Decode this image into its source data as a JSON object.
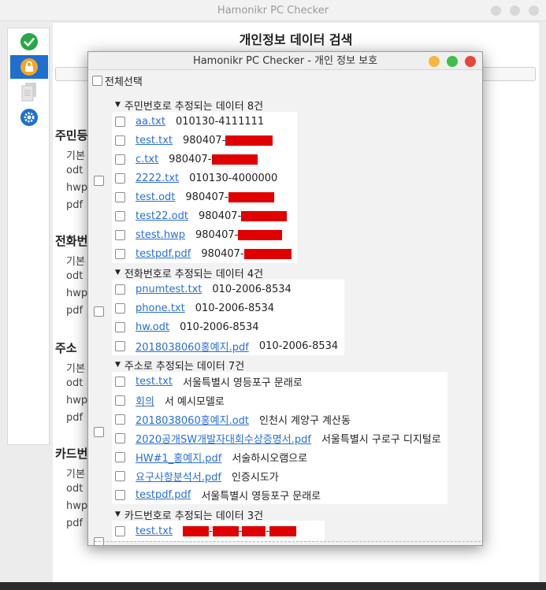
{
  "main_window": {
    "title": "Hamonikr PC Checker",
    "page_title": "개인정보 데이터 검색",
    "sidebar": {
      "items": [
        {
          "icon": "check-icon",
          "color": "#27a844"
        },
        {
          "icon": "lock-icon",
          "color": "#f5a623",
          "active": true
        },
        {
          "icon": "document-icon",
          "color": "#b8b8b8"
        },
        {
          "icon": "gear-icon",
          "color": "#1f6fd1"
        }
      ]
    },
    "sections": [
      {
        "heading": "주민등",
        "rows": [
          "기본",
          "odt",
          "hwp",
          "pdf"
        ]
      },
      {
        "heading": "전화번",
        "rows": [
          "기본",
          "odt",
          "hwp",
          "pdf"
        ]
      },
      {
        "heading": "주소",
        "rows": [
          "기본",
          "odt",
          "hwp",
          "pdf"
        ]
      },
      {
        "heading": "카드번",
        "rows": [
          "기본",
          "odt",
          "hwp",
          "pdf"
        ]
      }
    ]
  },
  "dialog": {
    "title": "Hamonikr PC Checker - 개인 정보 보호",
    "controls": {
      "minimize_color": "#f6b73c",
      "maximize_color": "#3dc04a",
      "close_color": "#e8453c"
    },
    "select_all_label": "전체선택",
    "redact_color": "#e00000",
    "groups": [
      {
        "header": "주민번호로 추정되는 데이터 8건",
        "items": [
          {
            "file": "aa.txt",
            "value": "010130-4111111"
          },
          {
            "file": "test.txt",
            "value": "980407-"
          },
          {
            "file": "c.txt",
            "value": "980407-"
          },
          {
            "file": "2222.txt",
            "value": "010130-4000000"
          },
          {
            "file": "test.odt",
            "value": "980407-"
          },
          {
            "file": "test22.odt",
            "value": "980407-"
          },
          {
            "file": "stest.hwp",
            "value": "980407-"
          },
          {
            "file": "testpdf.pdf",
            "value": "980407-"
          }
        ]
      },
      {
        "header": "전화번호로 추정되는 데이터 4건",
        "items": [
          {
            "file": "pnumtest.txt",
            "value": "010-2006-8534"
          },
          {
            "file": "phone.txt",
            "value": "010-2006-8534"
          },
          {
            "file": "hw.odt",
            "value": "010-2006-8534"
          },
          {
            "file": "2018038060홍예지.pdf",
            "value": "010-2006-8534"
          }
        ]
      },
      {
        "header": "주소로 추정되는 데이터 7건",
        "items": [
          {
            "file": "test.txt",
            "value": "서울특별시 영등포구 문래로"
          },
          {
            "file": "회의",
            "value": "서 예시모델로"
          },
          {
            "file": "2018038060홍예지.odt",
            "value": "인천시 계양구 계산동"
          },
          {
            "file": "2020공개SW개발자대회수상증명서.pdf",
            "value": "서울특별시 구로구 디지털로"
          },
          {
            "file": "HW#1_홍예지.pdf",
            "value": "서술하시오램으로"
          },
          {
            "file": "요구사항분석서.pdf",
            "value": "인증시도가"
          },
          {
            "file": "testpdf.pdf",
            "value": "서울특별시 영등포구 문래로"
          }
        ]
      },
      {
        "header": "카드번호로 추정되는 데이터 3건",
        "items": [
          {
            "file": "test.txt",
            "value": "",
            "sep": "-"
          }
        ]
      }
    ]
  }
}
